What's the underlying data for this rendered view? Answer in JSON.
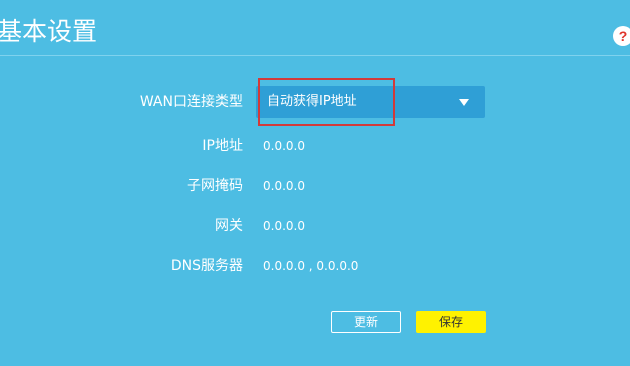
{
  "header": {
    "title": "基本设置",
    "help_label": "?"
  },
  "form": {
    "wan_type": {
      "label": "WAN口连接类型",
      "value": "自动获得IP地址"
    },
    "ip": {
      "label": "IP地址",
      "value": "0.0.0.0"
    },
    "subnet": {
      "label": "子网掩码",
      "value": "0.0.0.0"
    },
    "gateway": {
      "label": "网关",
      "value": "0.0.0.0"
    },
    "dns": {
      "label": "DNS服务器",
      "value": "0.0.0.0 , 0.0.0.0"
    }
  },
  "actions": {
    "refresh_label": "更新",
    "save_label": "保存"
  },
  "colors": {
    "background": "#4dbde3",
    "select_bg": "#2f9fd6",
    "highlight": "#d23a3a",
    "save_button": "#fff200"
  }
}
